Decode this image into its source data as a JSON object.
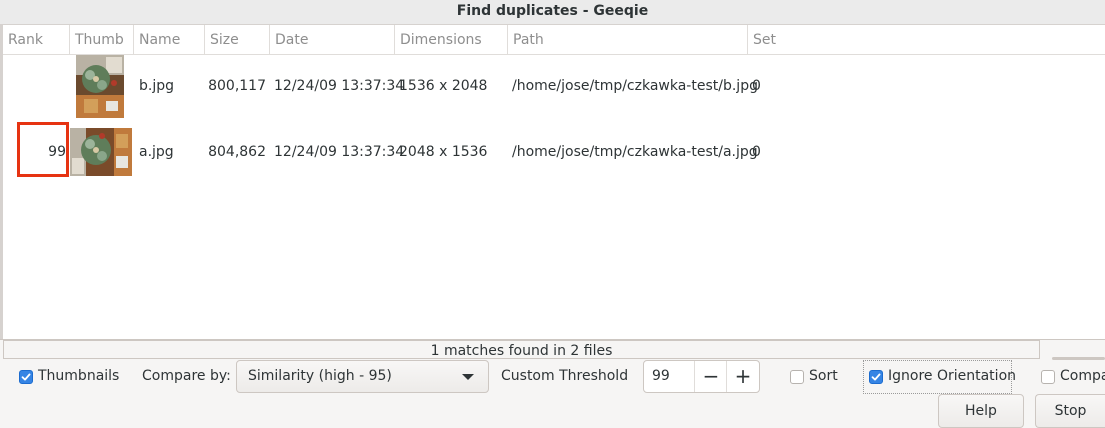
{
  "window": {
    "title": "Find duplicates - Geeqie"
  },
  "columns": [
    "Rank",
    "Thumb",
    "Name",
    "Size",
    "Date",
    "Dimensions",
    "Path",
    "Set"
  ],
  "rows": [
    {
      "rank": "",
      "name": "b.jpg",
      "size": "800,117",
      "date": "12/24/09 13:37:34",
      "dimensions": "1536 x 2048",
      "path": "/home/jose/tmp/czkawka-test/b.jpg",
      "set": "0"
    },
    {
      "rank": "99",
      "name": "a.jpg",
      "size": "804,862",
      "date": "12/24/09 13:37:34",
      "dimensions": "2048 x 1536",
      "path": "/home/jose/tmp/czkawka-test/a.jpg",
      "set": "0"
    }
  ],
  "status": {
    "text": "1 matches found in 2 files"
  },
  "controls": {
    "thumbnails_label": "Thumbnails",
    "thumbnails_checked": true,
    "compare_by_label": "Compare by:",
    "compare_by_value": "Similarity (high - 95)",
    "custom_threshold_label": "Custom Threshold",
    "threshold_value": "99",
    "minus_glyph": "−",
    "plus_glyph": "+",
    "sort_label": "Sort",
    "sort_checked": false,
    "ignore_orientation_label": "Ignore Orientation",
    "ignore_orientation_checked": true,
    "compare_partial_label": "Compa",
    "compare_partial_checked": false
  },
  "buttons": {
    "help": "Help",
    "stop": "Stop"
  },
  "colors": {
    "accent": "#3584e4",
    "highlight": "#e63312"
  }
}
